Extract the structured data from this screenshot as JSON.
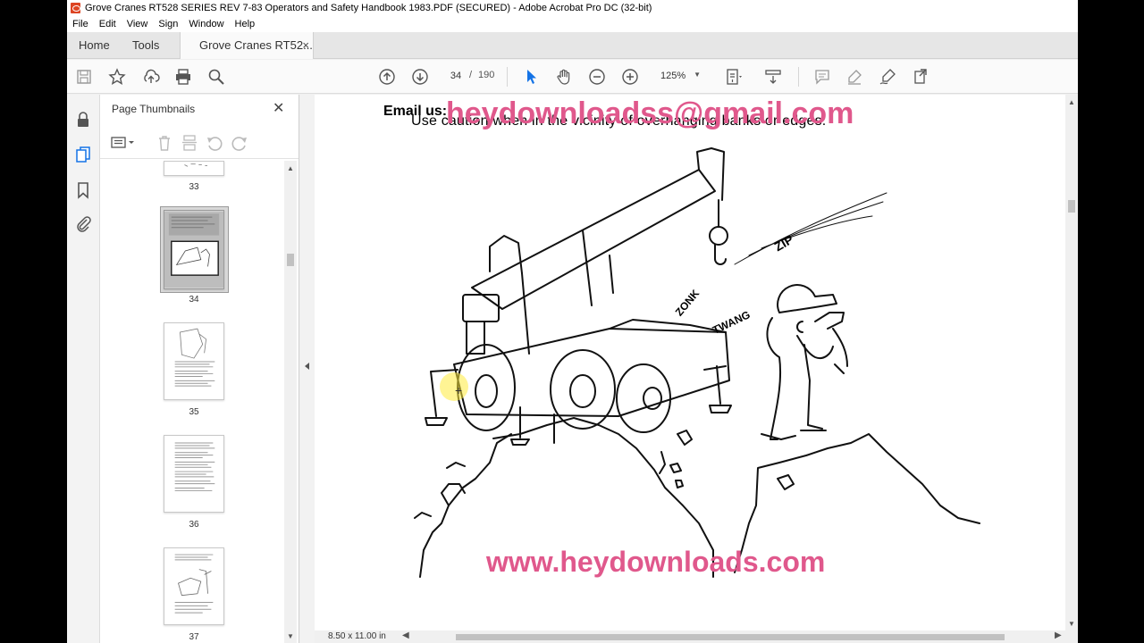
{
  "window": {
    "title": "Grove Cranes RT528 SERIES REV 7-83 Operators and Safety Handbook 1983.PDF (SECURED) - Adobe Acrobat Pro DC (32-bit)"
  },
  "menu": [
    "File",
    "Edit",
    "View",
    "Sign",
    "Window",
    "Help"
  ],
  "tabs": {
    "home": "Home",
    "tools": "Tools",
    "doc": "Grove Cranes RT52...",
    "close": "×"
  },
  "toolbar": {
    "page_current": "34",
    "page_sep": "/",
    "page_total": "190",
    "zoom": "125%",
    "icons": [
      "save-icon",
      "bookmark-star-icon",
      "upload-icon",
      "print-icon",
      "find-icon",
      "prev-page-icon",
      "next-page-icon",
      "select-arrow-icon",
      "hand-icon",
      "zoom-out-icon",
      "zoom-in-icon",
      "page-fit-icon",
      "scroll-mode-icon",
      "comment-icon",
      "highlight-icon",
      "sign-icon",
      "share-icon"
    ]
  },
  "rail": [
    "lock-icon",
    "thumbnails-icon",
    "bookmark-icon",
    "attachment-icon"
  ],
  "thumbnails": {
    "title": "Page Thumbnails",
    "close": "✕",
    "pages": [
      "33",
      "34",
      "35",
      "36",
      "37"
    ],
    "selected": "34"
  },
  "document": {
    "email_label": "Email us:",
    "caution_text": "Use caution when in the vicinity of overhanging banks or edges.",
    "watermark_email": "heydownloadss@gmail.com",
    "watermark_site": "www.heydownloads.com",
    "cartoon_sounds": [
      "ZIP",
      "ZONK",
      "TWANG"
    ],
    "page_size": "8.50 x 11.00 in"
  },
  "colors": {
    "watermark": "#e0588c",
    "toolbar_bg": "#fafafa",
    "doc_bg": "#e2e2e2"
  }
}
